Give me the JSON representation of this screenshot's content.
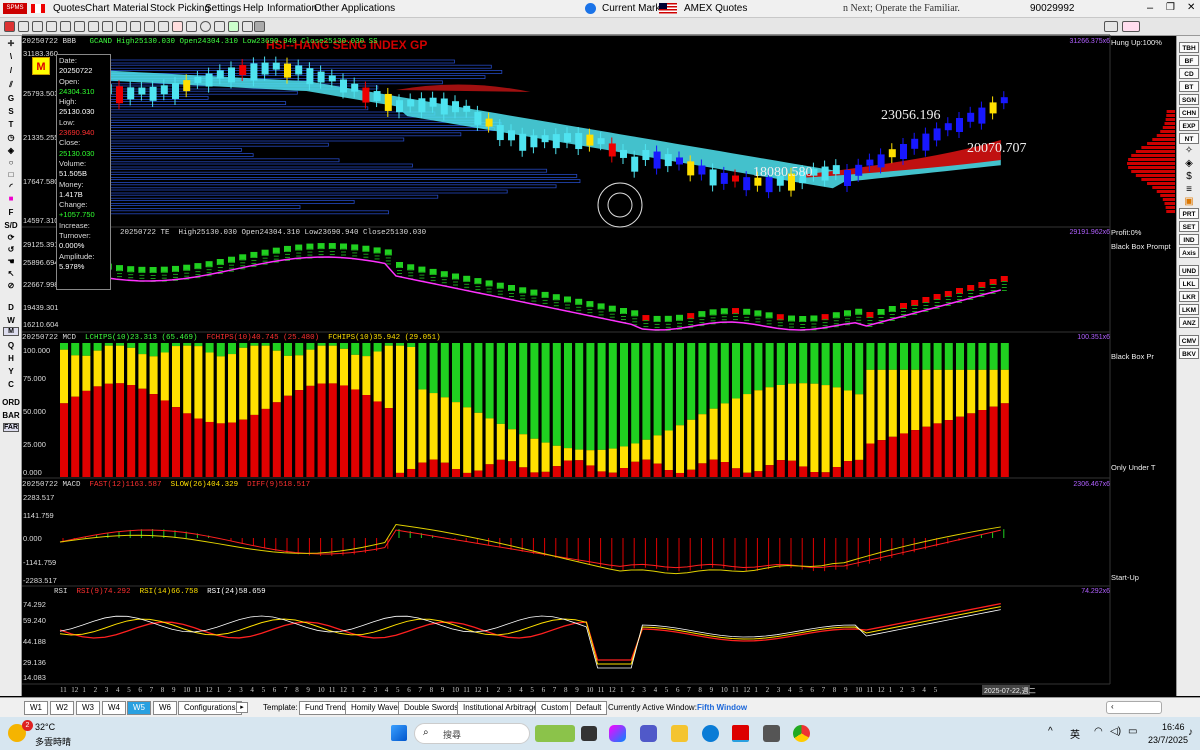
{
  "menu": {
    "items": [
      "Quotes",
      "Chart",
      "Material",
      "Stock Picking",
      "Settings",
      "Help",
      "Information",
      "Other Applications"
    ],
    "current_market_label": "Current Market:",
    "market_name": "AMEX Quotes",
    "marquee": "n Next; Operate the Familiar.",
    "account": "90029992"
  },
  "toolbar": {
    "title": "HSI--HANG SENG INDEX  GP"
  },
  "panel1": {
    "date": "20250722 BBB",
    "legend": "GCAND High25130.030 Open24304.310 Low23690.940 Close25130.030   SS",
    "right_value": "31266.375x6",
    "y_labels": [
      "31183.360",
      "25793.503",
      "21335.255",
      "17647.580",
      "14597.310"
    ],
    "annotations": [
      "23056.196",
      "20070.707",
      "18080.580"
    ],
    "side": "Hung Up:100%",
    "badge": "M"
  },
  "tooltip": {
    "labels": [
      "Date:",
      "Open:",
      "High:",
      "Low:",
      "Close:",
      "Volume:",
      "Money:",
      "Change:",
      "Increase:",
      "Turnover:",
      "Amplitude:"
    ],
    "values": [
      "20250722",
      "24304.310",
      "25130.030",
      "23690.940",
      "25130.030",
      "51.505B",
      "1.417B",
      "+1057.750",
      "",
      "0.000%",
      "5.978%"
    ]
  },
  "panel2": {
    "date": "20250722 TE",
    "legend": "High25130.030 Open24304.310 Low23690.940 Close25130.030",
    "right_value": "29191.962x6",
    "y_labels": [
      "29125.391",
      "25896.694",
      "22667.998",
      "19439.301",
      "16210.604"
    ],
    "side": [
      "Profit:0%",
      "Black Box Prompt"
    ]
  },
  "panel3": {
    "date": "20250722 MCD",
    "legend_parts": [
      "LCHIPS(10)23.313 (65.469)",
      "FCHIPS(10)40.745 (25.480)",
      "FCHIPS(10)35.942 (29.051)"
    ],
    "right_value": "100.351x6",
    "y_labels": [
      "100.000",
      "75.000",
      "50.000",
      "25.000",
      "0.000"
    ],
    "side": [
      "Black Box Pr",
      "Only Under T"
    ]
  },
  "panel4": {
    "date": "20250722 MACD",
    "legend_parts": [
      "FAST(12)1163.587",
      "SLOW(26)404.329",
      "DIFF(9)518.517"
    ],
    "right_value": "2306.467x6",
    "y_labels": [
      "2283.517",
      "1141.759",
      "0.000",
      "-1141.759",
      "-2283.517"
    ],
    "side": [
      "Start-Up"
    ]
  },
  "panel5": {
    "date": "RSI",
    "legend_parts": [
      "RSI(9)74.292",
      "RSI(14)66.758",
      "RSI(24)58.659"
    ],
    "right_value": "74.292x6",
    "y_labels": [
      "74.292",
      "59.240",
      "44.188",
      "29.136",
      "14.083"
    ]
  },
  "xaxis": {
    "labels": [
      "11",
      "12",
      "1",
      "2",
      "3",
      "4",
      "5",
      "6",
      "7",
      "8",
      "9",
      "10",
      "11",
      "12",
      "1",
      "2",
      "3",
      "4",
      "5",
      "6",
      "7",
      "8",
      "9",
      "10",
      "11",
      "12",
      "1",
      "2",
      "3",
      "4",
      "5",
      "6",
      "7",
      "8",
      "9",
      "10",
      "11",
      "12",
      "1",
      "2",
      "3",
      "4",
      "5",
      "6",
      "7",
      "8",
      "9",
      "10",
      "11",
      "12",
      "1",
      "2",
      "3",
      "4",
      "5",
      "6",
      "7",
      "8",
      "9",
      "10",
      "11",
      "12",
      "1",
      "2",
      "3",
      "4",
      "5",
      "6",
      "7",
      "8",
      "9",
      "10",
      "11",
      "12",
      "1",
      "2",
      "3",
      "4",
      "5"
    ],
    "last_date": "2025-07-22,週二"
  },
  "left_tools": [
    "F",
    "S/D",
    "D",
    "W",
    "M",
    "Q",
    "H",
    "Y",
    "C",
    "ORD",
    "BAR",
    "FAR"
  ],
  "right_tools": [
    "TBH",
    "BF",
    "CD",
    "BT",
    "SGN",
    "CHN",
    "EXP",
    "NT",
    "PRT",
    "SET",
    "IND",
    "Axis",
    "UND",
    "LKL",
    "LKR",
    "LKM",
    "ANZ",
    "CMV",
    "BKV"
  ],
  "bottom_tabs": [
    "W1",
    "W2",
    "W3",
    "W4",
    "W5",
    "W6",
    "Configurations"
  ],
  "template_label": "Template:",
  "template_tabs": [
    "Fund Trend",
    "Homily Wave",
    "Double Swords",
    "Institutional Arbitrage",
    "Custom",
    "Default"
  ],
  "active_window_label": "Currently Active Window:",
  "active_window": "Fifth Window",
  "taskbar": {
    "temp": "32°C",
    "weather": "多雲時晴",
    "search": "搜尋",
    "ime": "英",
    "time": "16:46",
    "date": "23/7/2025",
    "badge": "2"
  },
  "colors": {
    "up": "#ffe000",
    "down": "#e00000",
    "green": "#20d020",
    "cyan": "#4fe3f0",
    "blue": "#1818ff",
    "purple": "#b060ff"
  }
}
